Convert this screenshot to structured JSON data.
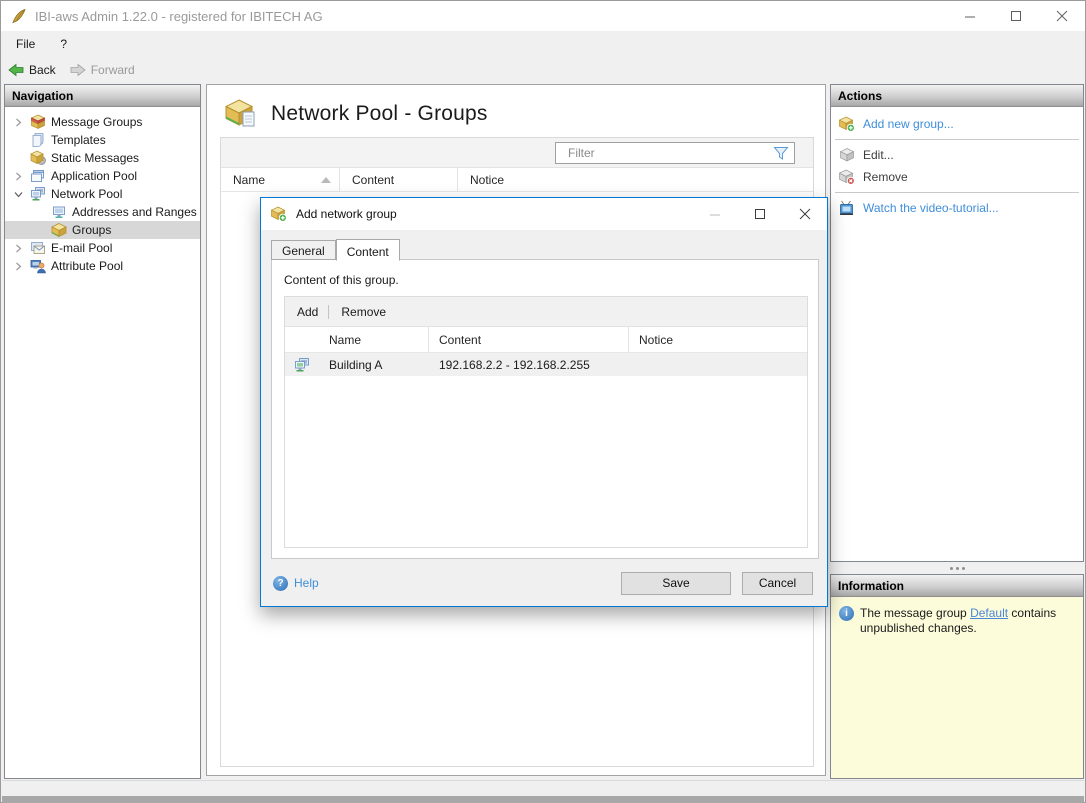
{
  "colors": {
    "accent": "#0078d7",
    "link": "#3e8ed9",
    "info_bg": "#fcfcdb",
    "selected_row": "#d7d7d7"
  },
  "window": {
    "title": "IBI-aws Admin 1.22.0 - registered for IBITECH AG"
  },
  "menu": {
    "items": [
      {
        "label": "File"
      },
      {
        "label": "?"
      }
    ]
  },
  "toolbar": {
    "back": "Back",
    "forward": "Forward"
  },
  "navigation": {
    "header": "Navigation",
    "items": [
      {
        "label": "Message Groups",
        "state": "collapsed"
      },
      {
        "label": "Templates",
        "state": "leaf"
      },
      {
        "label": "Static Messages",
        "state": "leaf"
      },
      {
        "label": "Application Pool",
        "state": "collapsed"
      },
      {
        "label": "Network Pool",
        "state": "expanded"
      },
      {
        "label": "Addresses and Ranges",
        "state": "leaf-child"
      },
      {
        "label": "Groups",
        "state": "leaf-child-selected"
      },
      {
        "label": "E-mail Pool",
        "state": "collapsed"
      },
      {
        "label": "Attribute Pool",
        "state": "collapsed"
      }
    ]
  },
  "main": {
    "title": "Network Pool - Groups",
    "filter_placeholder": "Filter",
    "columns": {
      "name": "Name",
      "content": "Content",
      "notice": "Notice"
    }
  },
  "actions": {
    "header": "Actions",
    "add_new_group": "Add new group...",
    "edit": "Edit...",
    "remove": "Remove",
    "watch_tutorial": "Watch the video-tutorial..."
  },
  "information": {
    "header": "Information",
    "text_before": "The message group ",
    "link_text": "Default",
    "text_after": " contains unpublished changes."
  },
  "dialog": {
    "title": "Add network group",
    "tabs": {
      "general": "General",
      "content": "Content"
    },
    "active_tab": "Content",
    "description": "Content of this group.",
    "toolbar": {
      "add": "Add",
      "remove": "Remove"
    },
    "columns": {
      "name": "Name",
      "content": "Content",
      "notice": "Notice"
    },
    "rows": [
      {
        "name": "Building A",
        "content": "192.168.2.2 - 192.168.2.255",
        "notice": ""
      }
    ],
    "help_label": "Help",
    "save_label": "Save",
    "cancel_label": "Cancel"
  },
  "icons": {
    "help_glyph": "?",
    "info_glyph": "i"
  }
}
